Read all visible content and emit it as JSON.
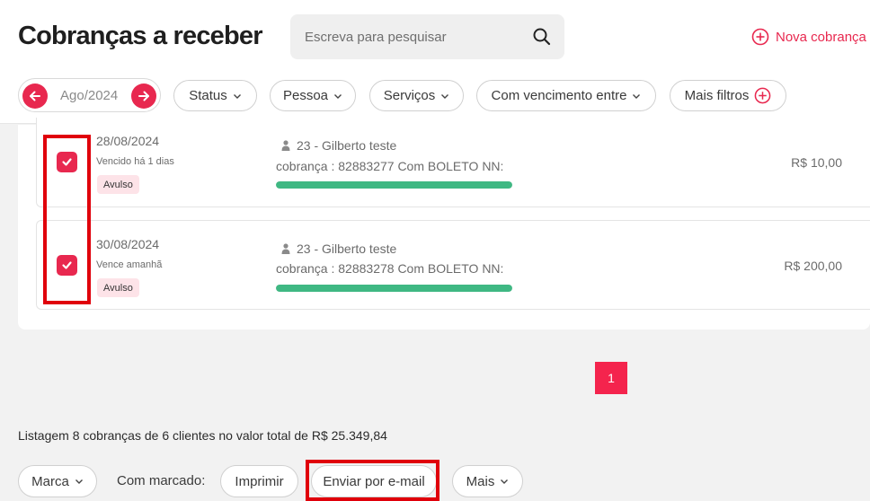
{
  "header": {
    "title": "Cobranças a receber",
    "search_placeholder": "Escreva para pesquisar",
    "new_charge_label": "Nova cobrança"
  },
  "filters": {
    "month": "Ago/2024",
    "status": "Status",
    "person": "Pessoa",
    "services": "Serviços",
    "due_between": "Com vencimento entre",
    "more_filters": "Mais filtros"
  },
  "charges": [
    {
      "date": "28/08/2024",
      "due_status": "Vencido há 1 dias",
      "type": "Avulso",
      "client": "23 - Gilberto teste",
      "description": "cobrança : 82883277 Com BOLETO NN:",
      "amount": "R$ 10,00",
      "checked": true,
      "progress": 1.0
    },
    {
      "date": "30/08/2024",
      "due_status": "Vence amanhã",
      "type": "Avulso",
      "client": "23 - Gilberto teste",
      "description": "cobrança : 82883278 Com BOLETO NN:",
      "amount": "R$ 200,00",
      "checked": true,
      "progress": 1.0
    }
  ],
  "pagination": {
    "current": "1"
  },
  "summary": "Listagem 8 cobranças de 6 clientes no valor total de R$ 25.349,84",
  "bulk_actions": {
    "mark": "Marca",
    "with_marked": "Com marcado:",
    "print": "Imprimir",
    "email": "Enviar por e-mail",
    "more": "Mais"
  },
  "colors": {
    "accent": "#e8284f",
    "highlight": "#e0000b",
    "progress": "#3fb883",
    "badge_bg": "#fde3e8"
  }
}
